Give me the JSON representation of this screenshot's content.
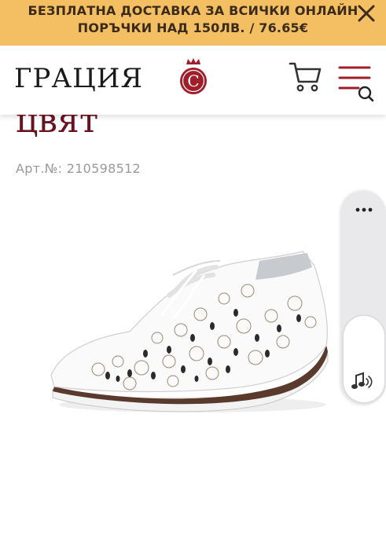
{
  "promo_banner": {
    "line1": "БЕЗПЛАТНА ДОСТАВКА ЗА ВСИЧКИ ОНЛАЙН",
    "line2": "ПОРЪЧКИ НАД 150ЛВ. / 76.65€",
    "close_icon": "close-icon",
    "background_color": "#f4bf63"
  },
  "header": {
    "logo_text": "ГРАЦИЯ",
    "logo_mark_letter": "C",
    "cart_icon": "cart-icon",
    "menu_icon": "menu-search-icon",
    "brand_color": "#a01e2a"
  },
  "product": {
    "title_partial": "цвят",
    "sku": "Арт.№: 210598512",
    "image_icon": "white-perforated-shoe-image"
  },
  "side_toolbar": {
    "more_icon": "more-dots-icon",
    "audio_icon": "speaker-audio-icon"
  }
}
